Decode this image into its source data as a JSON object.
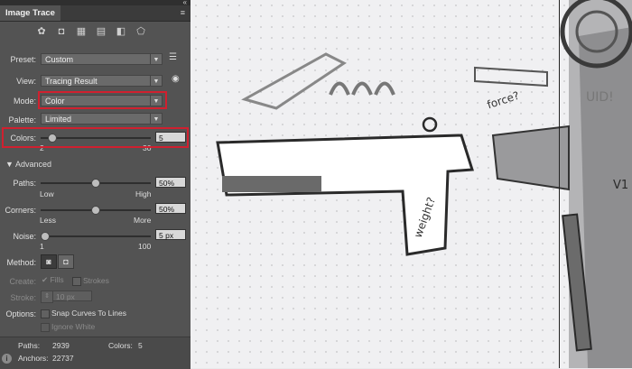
{
  "panel": {
    "title": "Image Trace",
    "preset": {
      "label": "Preset:",
      "value": "Custom"
    },
    "view": {
      "label": "View:",
      "value": "Tracing Result"
    },
    "mode": {
      "label": "Mode:",
      "value": "Color"
    },
    "palette": {
      "label": "Palette:",
      "value": "Limited"
    },
    "colors": {
      "label": "Colors:",
      "value": "5",
      "min": "2",
      "max": "30",
      "level": 0.11
    },
    "advanced": {
      "label": "Advanced"
    },
    "paths": {
      "label": "Paths:",
      "value": "50%",
      "min_label": "Low",
      "max_label": "High",
      "level": 0.5
    },
    "corners": {
      "label": "Corners:",
      "value": "50%",
      "min_label": "Less",
      "max_label": "More",
      "level": 0.5
    },
    "noise": {
      "label": "Noise:",
      "value": "5 px",
      "min": "1",
      "max": "100",
      "level": 0.04
    },
    "method": {
      "label": "Method:"
    },
    "create": {
      "label": "Create:",
      "fills": "Fills",
      "strokes": "Strokes"
    },
    "stroke": {
      "label": "Stroke:",
      "value": "10 px"
    },
    "options": {
      "label": "Options:",
      "snap": "Snap Curves To Lines",
      "ignore_white": "Ignore White"
    },
    "stats": {
      "paths_label": "Paths:",
      "paths_value": "2939",
      "colors_label": "Colors:",
      "colors_value": "5",
      "anchors_label": "Anchors:",
      "anchors_value": "22737"
    }
  },
  "canvas": {
    "annotations": [
      "force?",
      "weight?",
      "UID!",
      "V1"
    ]
  },
  "accent": {
    "highlight": "#d0202f",
    "panel_bg": "#535353",
    "canvas_bg": "#f0f0f2"
  }
}
